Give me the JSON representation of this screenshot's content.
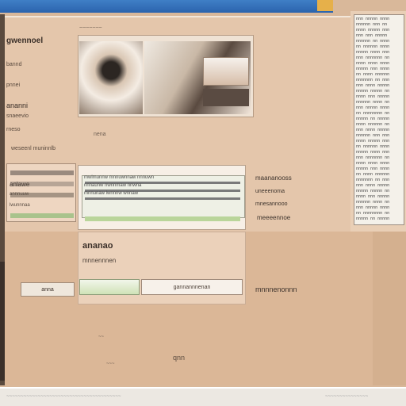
{
  "window": {
    "title": ""
  },
  "sidebar": {
    "items": [
      {
        "label": "gwennoel",
        "style": "bold"
      },
      {
        "label": "bannd",
        "style": "small"
      },
      {
        "label": "pnnei",
        "style": "small"
      },
      {
        "label": "ananni",
        "style": "normal"
      },
      {
        "label": "snaeevio",
        "style": "small"
      },
      {
        "label": "rneso",
        "style": "small"
      },
      {
        "label": "weseenl muninnlb",
        "style": "small"
      }
    ]
  },
  "gallery": {
    "caption_left": "~~~~~~~",
    "caption_right": "~~~~~~~~~~~~~~~~~~",
    "photo_caption": "nena"
  },
  "middle": {
    "left_panel_title": "anlawe",
    "left_panel_lines": [
      "annnuuw",
      "lwunnnaa"
    ],
    "center_rows": [
      "mwlmunnw mnnuwnnaw nnnuwn",
      "nnnaunw nwnnmaw nnwna",
      "mnnunaw lwnnnw wnnaw"
    ],
    "right_items": [
      "maananooss",
      "uneeenoma",
      "mnesannooo",
      "meeeennoe"
    ]
  },
  "form": {
    "title": "ananao",
    "subtitle": "mnnennnen",
    "button_left": "anma",
    "field_label": "gannannnenan",
    "left_label": "anna",
    "right_status": "mnnnenonnn"
  },
  "lower": {
    "labels": [
      "~~",
      "~~~",
      "qnn"
    ]
  },
  "right_list": {
    "rows": [
      "nnn  nnnnn nnnn",
      "nnnnnn nnn nn",
      "nnnn nnnnn nnn",
      "nnn nnn nnnnn",
      "nnnnnn nn nnnn",
      "nn nnnnnn nnnn",
      "nnnnn nnnn nnn",
      "nnn nnnnnnn nn",
      "nnnn nnnn nnnn",
      "nnnnn nnn nnnn",
      "nn nnnn nnnnnn",
      "nnnnnnn nn nnn",
      "nnn nnnn nnnnn",
      "nnnnn nnnnn nn",
      "nnnn nnn nnnnn",
      "nnnnnn nnnn nn",
      "nnn nnnnn nnnn",
      "nn nnnnnnnn nn",
      "nnnnn nn nnnnn",
      "nnnn nnnnnn nn",
      "nnn nnnn nnnnn",
      "nnnnnn nnn nnn",
      "nnnn nnnnn nnn",
      "nn nnnnnn nnnn",
      "nnnnn nnnn nnn",
      "nnn nnnnnnn nn",
      "nnnn nnnn nnnn",
      "nnnnn nnn nnnn",
      "nn nnnn nnnnnn",
      "nnnnnnn nn nnn",
      "nnn nnnn nnnnn",
      "nnnnn nnnnn nn",
      "nnnn nnn nnnnn",
      "nnnnnn nnnn nn",
      "nnn nnnnn nnnn",
      "nn nnnnnnnn nn",
      "nnnnn nn nnnnn"
    ]
  },
  "bottom": {
    "left": "~~~~~~~~~~~~~~~~~~~~~~~~~~~~~~~~~~~~~~~~",
    "right": "~~~~~~~~~~~~~~~"
  },
  "colors": {
    "accent": "#2b63ad",
    "panel": "#e4c6ab",
    "background": "#d9b89a"
  }
}
